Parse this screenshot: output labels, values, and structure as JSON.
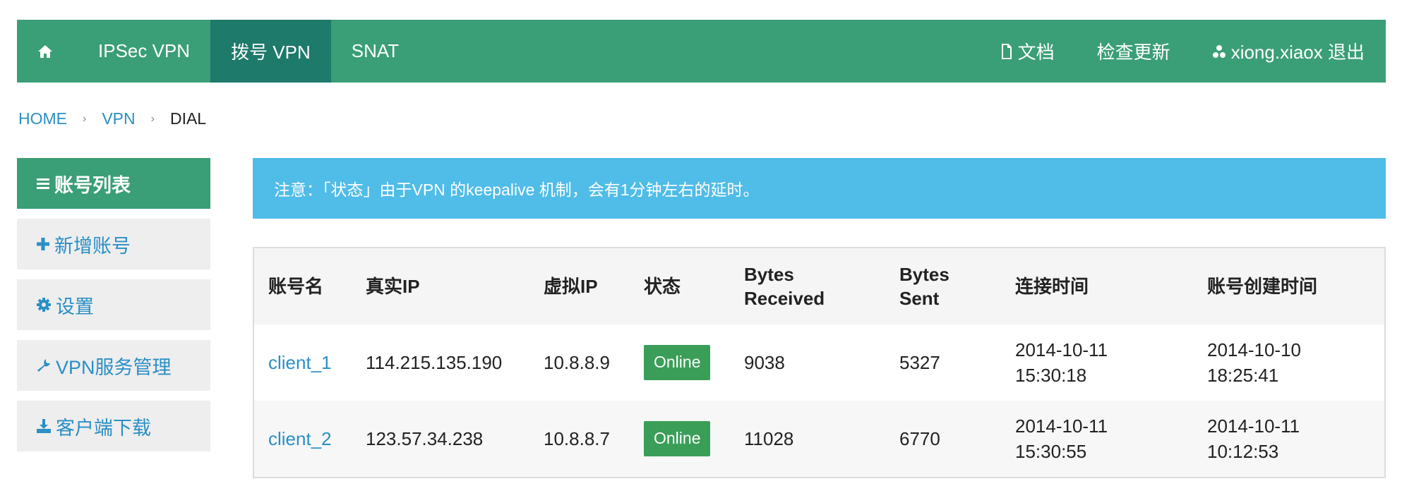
{
  "navbar": {
    "home_icon": "home-icon",
    "items": [
      {
        "label": "IPSec VPN"
      },
      {
        "label": "拨号 VPN"
      },
      {
        "label": "SNAT"
      }
    ],
    "right": {
      "docs_label": "文档",
      "docs_icon": "document-icon",
      "check_update_label": "检查更新",
      "user_icon": "user-icon",
      "user_label": "xiong.xiaox 退出"
    },
    "colors": {
      "bar": "#3a9e77",
      "active": "#1e7a6a"
    }
  },
  "breadcrumb": {
    "items": [
      "HOME",
      "VPN",
      "DIAL"
    ],
    "separator": "›"
  },
  "sidebar": {
    "items": [
      {
        "label": "账号列表",
        "icon": "list-icon"
      },
      {
        "label": "新增账号",
        "icon": "plus-icon"
      },
      {
        "label": "设置",
        "icon": "gear-icon"
      },
      {
        "label": "VPN服务管理",
        "icon": "wrench-icon"
      },
      {
        "label": "客户端下载",
        "icon": "download-icon"
      }
    ]
  },
  "notice": {
    "text": "注意：「状态」由于VPN 的keepalive 机制，会有1分钟左右的延时。"
  },
  "table": {
    "headers": [
      "账号名",
      "真实IP",
      "虚拟IP",
      "状态",
      "Bytes Received",
      "Bytes Sent",
      "连接时间",
      "账号创建时间"
    ],
    "rows": [
      {
        "name": "client_1",
        "real_ip": "114.215.135.190",
        "virtual_ip": "10.8.8.9",
        "status": "Online",
        "bytes_received": "9038",
        "bytes_sent": "5327",
        "connect_date": "2014-10-11",
        "connect_time": "15:30:18",
        "created_date": "2014-10-10",
        "created_time": "18:25:41"
      },
      {
        "name": "client_2",
        "real_ip": "123.57.34.238",
        "virtual_ip": "10.8.8.7",
        "status": "Online",
        "bytes_received": "11028",
        "bytes_sent": "6770",
        "connect_date": "2014-10-11",
        "connect_time": "15:30:55",
        "created_date": "2014-10-11",
        "created_time": "10:12:53"
      }
    ],
    "status_color": "#3a9e58"
  }
}
